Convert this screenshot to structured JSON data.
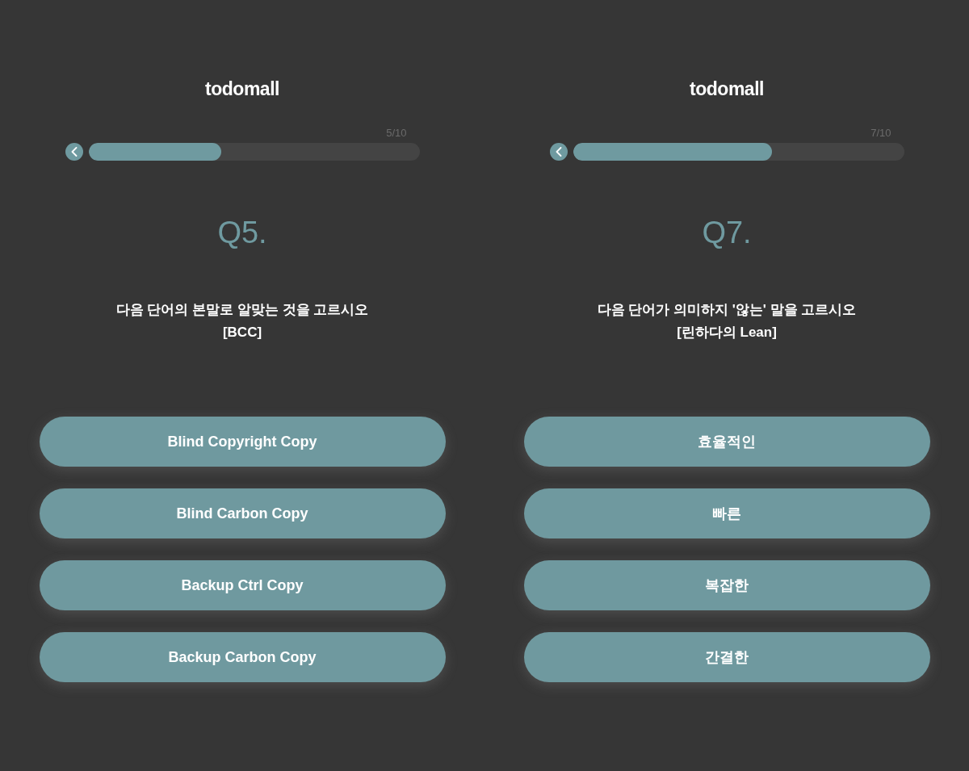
{
  "panels": [
    {
      "logo": "todomall",
      "progress": {
        "counter": "5/10",
        "level": 0.4
      },
      "question": {
        "number": "Q5.",
        "text": "다음 단어의 본말로 알맞는 것을 고르시오",
        "term": "[BCC]"
      },
      "options": [
        "Blind Copyright Copy",
        "Blind Carbon Copy",
        "Backup Ctrl Copy",
        "Backup Carbon Copy"
      ]
    },
    {
      "logo": "todomall",
      "progress": {
        "counter": "7/10",
        "level": 0.6
      },
      "question": {
        "number": "Q7.",
        "text": "다음 단어가 의미하지 '않는' 말을 고르시오",
        "term": "[린하다의 Lean]"
      },
      "options": [
        "효율적인",
        "빠른",
        "복잡한",
        "간결한"
      ]
    }
  ]
}
